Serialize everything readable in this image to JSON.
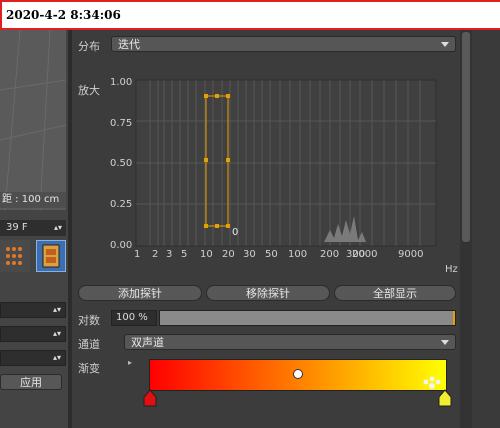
{
  "timestamp": "2020-4-2 8:34:06",
  "left": {
    "viewport_label": "距 : 100 cm",
    "frame_value": "39 F",
    "apply_button": "应用"
  },
  "distribution": {
    "label": "分布",
    "value": "迭代"
  },
  "graph": {
    "y_label": "放大",
    "y_ticks": [
      "1.00",
      "0.75",
      "0.50",
      "0.25",
      "0.00"
    ],
    "x_ticks": [
      "1",
      "2",
      "3",
      "5",
      "10",
      "20",
      "30",
      "50",
      "100",
      "200",
      "300",
      "600",
      "2000",
      "9000"
    ],
    "x_unit": "Hz",
    "marker_label": "0"
  },
  "buttons": {
    "add_probe": "添加探针",
    "remove_probe": "移除探针",
    "show_all": "全部显示"
  },
  "log": {
    "label": "对数",
    "value": "100 %",
    "fill": 1.0
  },
  "channel": {
    "label": "通道",
    "value": "双声道"
  },
  "gradient": {
    "label": "渐变",
    "start_color": "#ff0000",
    "end_color": "#ffff00"
  },
  "colors": {
    "accent": "#e8a000",
    "panel": "#3c3c3c",
    "highlight": "#e0201e"
  }
}
